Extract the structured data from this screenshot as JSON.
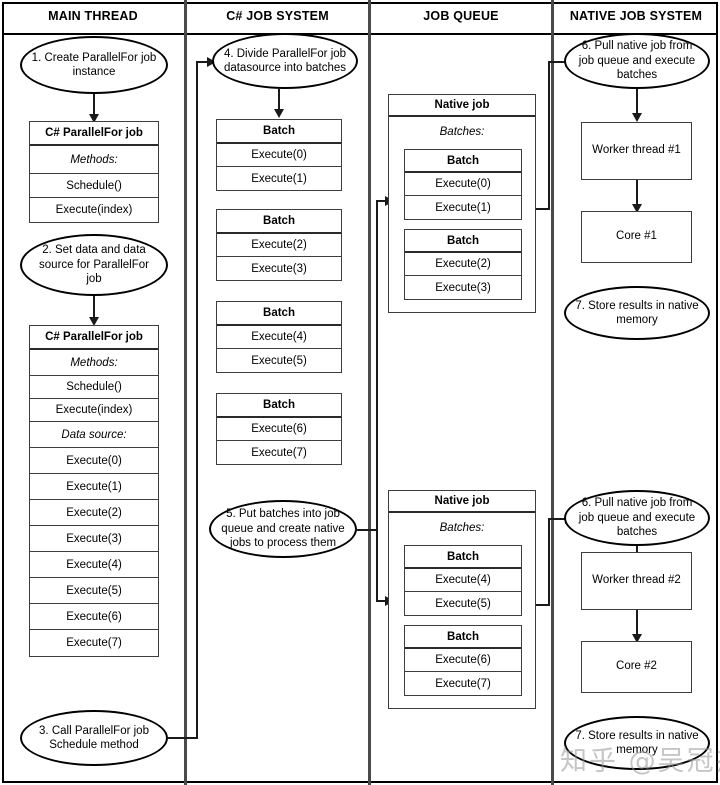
{
  "lanes": [
    {
      "title": "MAIN THREAD"
    },
    {
      "title": "C# JOB SYSTEM"
    },
    {
      "title": "JOB QUEUE"
    },
    {
      "title": "NATIVE JOB SYSTEM"
    }
  ],
  "main_thread": {
    "step1": "1. Create ParallelFor job instance",
    "job_a": {
      "header": "C# ParallelFor job",
      "section_methods": "Methods:",
      "methods": [
        "Schedule()",
        "Execute(index)"
      ]
    },
    "step2": "2. Set data and data source for ParallelFor job",
    "job_b": {
      "header": "C# ParallelFor job",
      "section_methods": "Methods:",
      "methods": [
        "Schedule()",
        "Execute(index)"
      ],
      "section_datasource": "Data source:",
      "datasource": [
        "Execute(0)",
        "Execute(1)",
        "Execute(2)",
        "Execute(3)",
        "Execute(4)",
        "Execute(5)",
        "Execute(6)",
        "Execute(7)"
      ]
    },
    "step3": "3. Call ParallelFor job Schedule method"
  },
  "cs_job_system": {
    "step4": "4. Divide ParallelFor job datasource into batches",
    "batches": [
      {
        "header": "Batch",
        "items": [
          "Execute(0)",
          "Execute(1)"
        ]
      },
      {
        "header": "Batch",
        "items": [
          "Execute(2)",
          "Execute(3)"
        ]
      },
      {
        "header": "Batch",
        "items": [
          "Execute(4)",
          "Execute(5)"
        ]
      },
      {
        "header": "Batch",
        "items": [
          "Execute(6)",
          "Execute(7)"
        ]
      }
    ],
    "step5": "5. Put batches into job queue and create native jobs to process them"
  },
  "job_queue": {
    "native_jobs": [
      {
        "header": "Native job",
        "section": "Batches:",
        "batches": [
          {
            "header": "Batch",
            "items": [
              "Execute(0)",
              "Execute(1)"
            ]
          },
          {
            "header": "Batch",
            "items": [
              "Execute(2)",
              "Execute(3)"
            ]
          }
        ]
      },
      {
        "header": "Native job",
        "section": "Batches:",
        "batches": [
          {
            "header": "Batch",
            "items": [
              "Execute(4)",
              "Execute(5)"
            ]
          },
          {
            "header": "Batch",
            "items": [
              "Execute(6)",
              "Execute(7)"
            ]
          }
        ]
      }
    ]
  },
  "native_job_system": {
    "threads": [
      {
        "step6": "6. Pull native job from job queue and execute batches",
        "worker": "Worker thread #1",
        "core": "Core #1",
        "step7": "7. Store results in native memory"
      },
      {
        "step6": "6. Pull native job from job queue and execute batches",
        "worker": "Worker thread #2",
        "core": "Core #2",
        "step7": "7. Store results in native memory"
      }
    ]
  },
  "watermark": "知乎 @吴冠杰",
  "colors": {
    "line": "#1a1a1a",
    "box_border": "#3d3d3d",
    "divider": "#4a4a4a",
    "background": "#ffffff"
  }
}
